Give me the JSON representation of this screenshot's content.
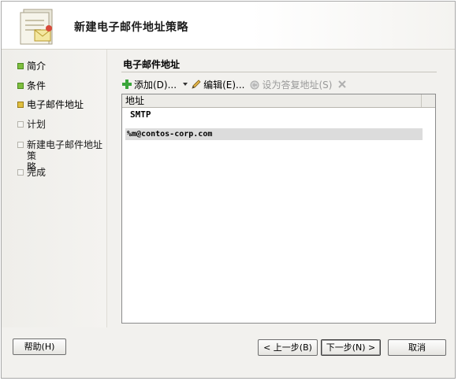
{
  "window": {
    "title": "新建电子邮件地址策略"
  },
  "nav": {
    "items": [
      {
        "label": "简介",
        "state": "done"
      },
      {
        "label": "条件",
        "state": "done"
      },
      {
        "label": "电子邮件地址",
        "state": "current"
      },
      {
        "label": "计划",
        "state": "pending"
      },
      {
        "label": "新建电子邮件地址策\n略",
        "state": "pending"
      },
      {
        "label": "完成",
        "state": "pending"
      }
    ]
  },
  "content": {
    "section_title": "电子邮件地址",
    "toolbar": {
      "add_label": "添加(D)...",
      "edit_label": "编辑(E)...",
      "set_reply_label": "设为答复地址(S)"
    },
    "list": {
      "column_header": "地址",
      "group": "SMTP",
      "rows": [
        "%m@contos-corp.com"
      ]
    }
  },
  "footer": {
    "help_label": "帮助(H)",
    "back_label": "< 上一步(B)",
    "next_label": "下一步(N) >",
    "cancel_label": "取消"
  },
  "colors": {
    "done": "#7fbf3f",
    "current": "#e0bf3f",
    "pending": "#f6f6f4",
    "add_icon": "#3aa53a"
  },
  "icons": {
    "header": "wizard-document-icon",
    "add": "plus-icon",
    "edit": "pencil-icon",
    "set_reply": "reply-address-icon",
    "delete": "delete-x-icon"
  }
}
